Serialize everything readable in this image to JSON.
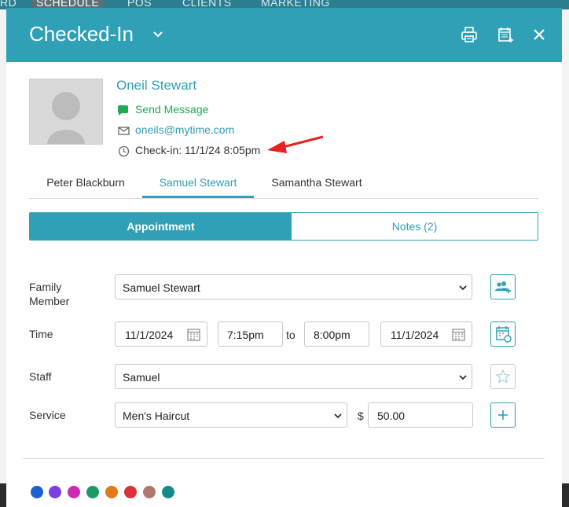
{
  "background_nav": {
    "items": [
      "RD",
      "SCHEDULE",
      "POS",
      "CLIENTS",
      "MARKETING"
    ]
  },
  "header": {
    "title": "Checked-In"
  },
  "client": {
    "name": "Oneil Stewart",
    "send_message": "Send Message",
    "email": "oneils@mytime.com",
    "checkin": "Check-in: 11/1/24 8:05pm"
  },
  "family_tabs": [
    "Peter Blackburn",
    "Samuel Stewart",
    "Samantha Stewart"
  ],
  "segments": {
    "appointment": "Appointment",
    "notes": "Notes (2)"
  },
  "form": {
    "family_member": {
      "label": "Family Member",
      "value": "Samuel Stewart"
    },
    "time": {
      "label": "Time",
      "start_date": "11/1/2024",
      "start_time": "7:15pm",
      "to": "to",
      "end_time": "8:00pm",
      "end_date": "11/1/2024"
    },
    "staff": {
      "label": "Staff",
      "value": "Samuel"
    },
    "service": {
      "label": "Service",
      "value": "Men's Haircut",
      "currency": "$",
      "price": "50.00"
    }
  },
  "colors": {
    "accent": "#30a0b6",
    "swatches": [
      "#1f5fd6",
      "#7b3fe0",
      "#cc2ab0",
      "#1a9a6a",
      "#e07a1a",
      "#d9343a",
      "#b0786a",
      "#168a8a"
    ]
  }
}
